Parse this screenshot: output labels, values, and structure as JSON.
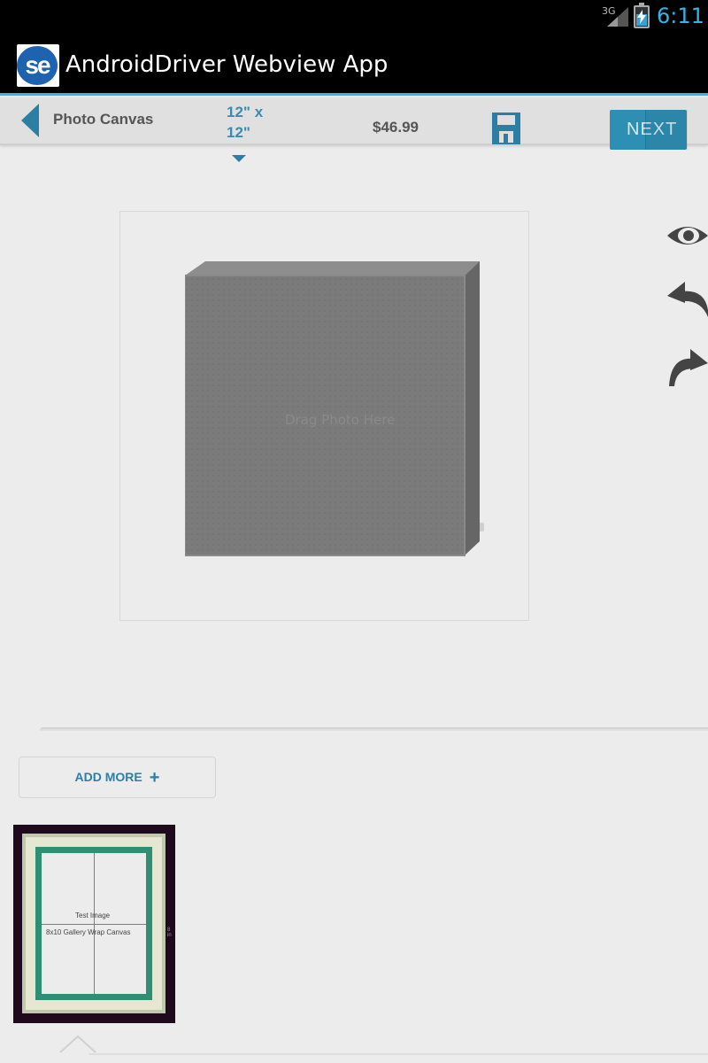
{
  "status_bar": {
    "network": "3G",
    "time": "6:11",
    "battery_level": 0.6,
    "signal_icon": "signal-icon",
    "battery_icon": "battery-charging-icon"
  },
  "action_bar": {
    "logo_text": "se",
    "title": "AndroidDriver Webview App",
    "accent_color": "#33b5e5"
  },
  "toolbar": {
    "back_icon": "back-arrow-icon",
    "title": "Photo Canvas",
    "size_line1": "12\" x",
    "size_line2": "12\"",
    "price": "$46.99",
    "save_icon": "save-icon",
    "next_label": "NEXT",
    "accent_color": "#2e8fb5"
  },
  "canvas": {
    "placeholder": "Drag Photo Here"
  },
  "side_tools": [
    {
      "icon": "eye-icon",
      "name": "preview"
    },
    {
      "icon": "undo-icon",
      "name": "undo"
    },
    {
      "icon": "redo-icon",
      "name": "redo"
    }
  ],
  "add_more": {
    "label": "ADD MORE",
    "plus": "+"
  },
  "thumbnail": {
    "line1": "Test Image",
    "line2": "8x10 Gallery Wrap Canvas",
    "side_label": "8 in"
  }
}
